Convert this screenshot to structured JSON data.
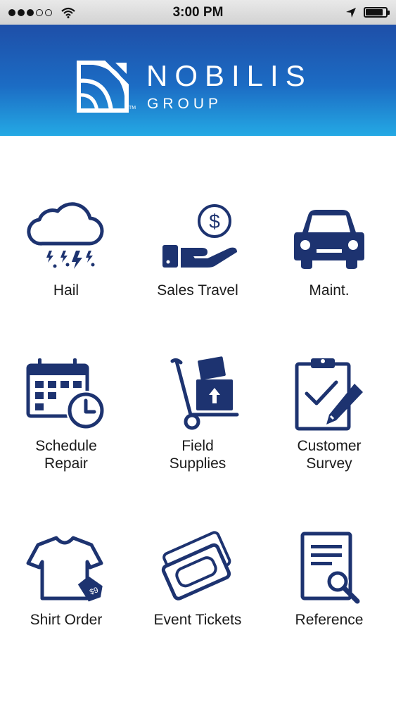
{
  "status_bar": {
    "signal_dots_filled": 3,
    "signal_dots_total": 5,
    "time": "3:00 PM",
    "icons": [
      "wifi-icon",
      "location-arrow-icon",
      "battery-icon"
    ],
    "battery_level": 0.85
  },
  "header": {
    "brand_name": "NOBILIS",
    "brand_sub": "GROUP",
    "trademark": "TM",
    "colors": {
      "top": "#1e4fa8",
      "bottom": "#24a9e4"
    }
  },
  "accent_color": "#1d3370",
  "tiles": [
    {
      "label": "Hail",
      "icon": "hail-cloud-icon"
    },
    {
      "label": "Sales Travel",
      "icon": "dollar-hand-icon"
    },
    {
      "label": "Maint.",
      "icon": "car-icon"
    },
    {
      "label": "Schedule\nRepair",
      "icon": "calendar-clock-icon"
    },
    {
      "label": "Field\nSupplies",
      "icon": "hand-truck-icon"
    },
    {
      "label": "Customer\nSurvey",
      "icon": "clipboard-check-icon"
    },
    {
      "label": "Shirt Order",
      "icon": "shirt-tag-icon"
    },
    {
      "label": "Event Tickets",
      "icon": "tickets-icon"
    },
    {
      "label": "Reference",
      "icon": "document-search-icon"
    }
  ]
}
